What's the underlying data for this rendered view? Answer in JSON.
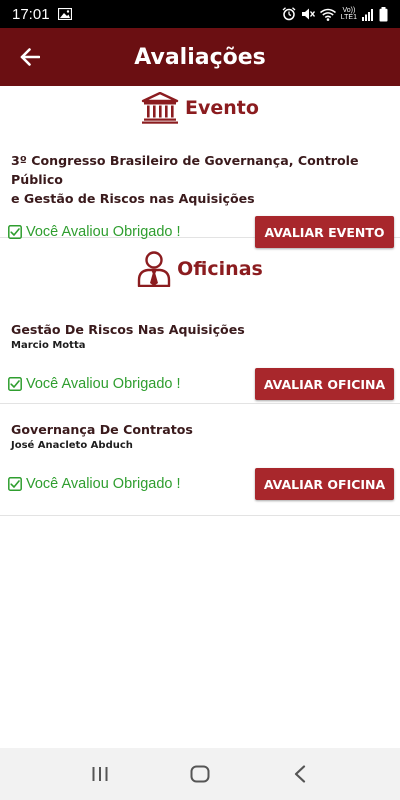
{
  "status_bar": {
    "time": "17:01",
    "network_label_top": "Vo))",
    "network_label_bottom": "LTE1",
    "icons": [
      "image-icon",
      "alarm-icon",
      "mute-icon",
      "wifi-icon",
      "signal-icon",
      "battery-icon"
    ]
  },
  "app_bar": {
    "title": "Avaliações",
    "back_icon": "arrow-left-icon"
  },
  "colors": {
    "app_bar": "#6b0f12",
    "accent": "#8b1c1f",
    "button": "#a8272c",
    "rated_green": "#2f9e2f"
  },
  "evento_section": {
    "header": "Evento",
    "icon": "institution-icon",
    "card": {
      "title_line1": "3º Congresso Brasileiro de Governança, Controle Público",
      "title_line2": "e Gestão de Riscos nas Aquisições",
      "rated_text": "Você Avaliou Obrigado !",
      "button_label": "AVALIAR EVENTO"
    }
  },
  "oficinas_section": {
    "header": "Oficinas",
    "icon": "person-tie-icon",
    "items": [
      {
        "title": "Gestão De Riscos Nas Aquisições",
        "speaker": "Marcio Motta",
        "rated_text": "Você Avaliou Obrigado !",
        "button_label": "AVALIAR OFICINA"
      },
      {
        "title": "Governança De Contratos",
        "speaker": "José Anacleto Abduch",
        "rated_text": "Você Avaliou Obrigado !",
        "button_label": "AVALIAR OFICINA"
      }
    ]
  },
  "nav_bar": {
    "buttons": [
      "recent-apps-icon",
      "home-icon",
      "back-icon"
    ]
  }
}
